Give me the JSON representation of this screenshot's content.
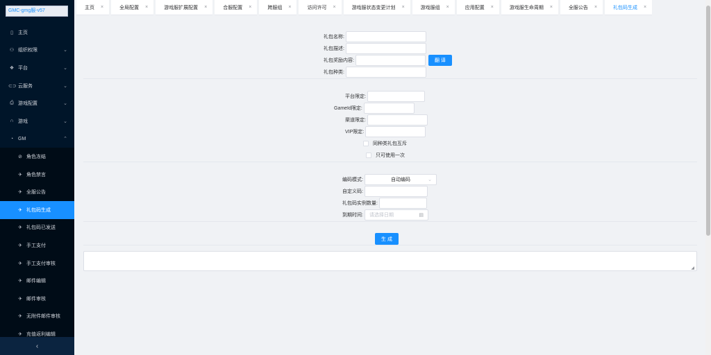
{
  "sidebar": {
    "logo_text": "GMC-gmg服-v57",
    "items": [
      {
        "label": "主页",
        "icon": "home-icon",
        "glyph": "▯",
        "arrow": ""
      },
      {
        "label": "组织权限",
        "icon": "user-icon",
        "glyph": "⚇",
        "arrow": "⌄"
      },
      {
        "label": "平台",
        "icon": "platform-icon",
        "glyph": "❖",
        "arrow": "⌄"
      },
      {
        "label": "云服务",
        "icon": "link-icon",
        "glyph": "⊂⊃",
        "arrow": "⌄"
      },
      {
        "label": "游戏配置",
        "icon": "config-icon",
        "glyph": "⎙",
        "arrow": "⌄"
      },
      {
        "label": "游戏",
        "icon": "headset-icon",
        "glyph": "∩",
        "arrow": "⌄"
      },
      {
        "label": "GM",
        "icon": "gm-icon",
        "glyph": "◔",
        "arrow": "⌃"
      }
    ],
    "sub_items": [
      {
        "label": "角色冻结",
        "glyph": "⊘",
        "active": false
      },
      {
        "label": "角色禁言",
        "glyph": "✈",
        "active": false
      },
      {
        "label": "全服公告",
        "glyph": "✈",
        "active": false
      },
      {
        "label": "礼包码生成",
        "glyph": "✈",
        "active": true
      },
      {
        "label": "礼包码已发送",
        "glyph": "✈",
        "active": false
      },
      {
        "label": "手工支付",
        "glyph": "✈",
        "active": false
      },
      {
        "label": "手工支付审核",
        "glyph": "✈",
        "active": false
      },
      {
        "label": "邮件编辑",
        "glyph": "✈",
        "active": false
      },
      {
        "label": "邮件审核",
        "glyph": "✈",
        "active": false
      },
      {
        "label": "无附件邮件审核",
        "glyph": "✈",
        "active": false
      },
      {
        "label": "充值返利编辑",
        "glyph": "✈",
        "active": false
      }
    ],
    "collapse_glyph": "‹"
  },
  "tabs": [
    {
      "label": "主页",
      "active": false
    },
    {
      "label": "全局配置",
      "active": false
    },
    {
      "label": "游戏服扩展配置",
      "active": false
    },
    {
      "label": "合服配置",
      "active": false
    },
    {
      "label": "跨服组",
      "active": false
    },
    {
      "label": "访问许可",
      "active": false
    },
    {
      "label": "游戏服状态变更计划",
      "active": false
    },
    {
      "label": "游戏服组",
      "active": false
    },
    {
      "label": "应用配置",
      "active": false
    },
    {
      "label": "游戏服生命周期",
      "active": false
    },
    {
      "label": "全服公告",
      "active": false
    },
    {
      "label": "礼包码生成",
      "active": true
    }
  ],
  "tab_close_glyph": "×",
  "form": {
    "gift_name_label": "礼包名称:",
    "gift_desc_label": "礼包描述:",
    "reward_label": "礼包奖励内容:",
    "detail_button": "翻 译",
    "gift_type_label": "礼包种类:",
    "platform_label": "平台限定:",
    "gameid_label": "GameId限定:",
    "channel_label": "渠道限定:",
    "vip_label": "VIP限定:",
    "mutex_label": "同种类礼包互斥",
    "once_label": "只可使用一次",
    "code_mode_label": "编码模式:",
    "code_mode_value": "自动编码",
    "custom_code_label": "自定义码:",
    "instance_count_label": "礼包码实例数量:",
    "expire_label": "到期时间:",
    "expire_placeholder": "请选择日期",
    "generate_button": "生 成"
  }
}
